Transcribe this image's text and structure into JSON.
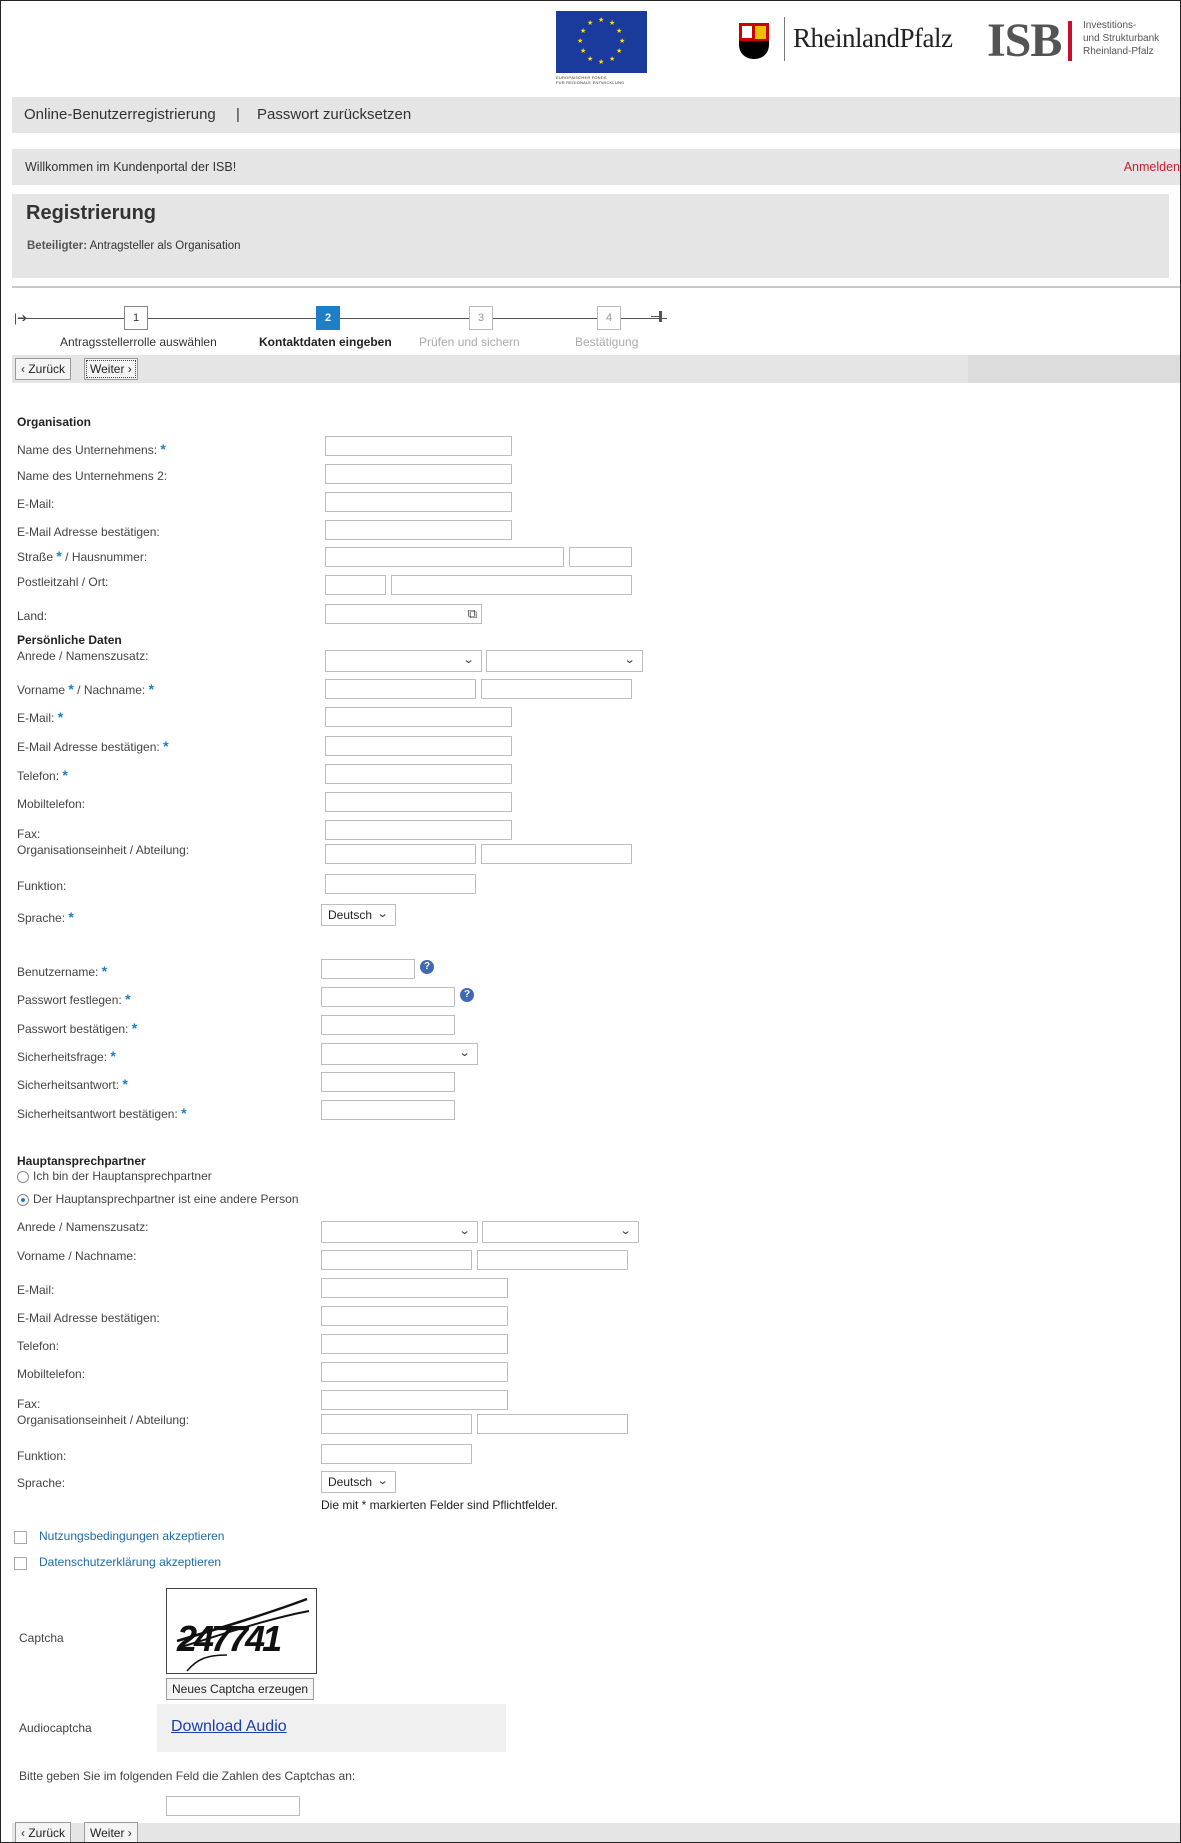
{
  "header": {
    "eu_caption_line1": "EUROPÄISCHER FONDS",
    "eu_caption_line2": "FÜR REGIONALE ENTWICKLUNG",
    "rlp_name": "RheinlandPfalz",
    "isb_letters": "ISB",
    "isb_sub1": "Investitions-",
    "isb_sub2": "und Strukturbank",
    "isb_sub3": "Rheinland-Pfalz"
  },
  "nav": {
    "registration": "Online-Benutzerregistrierung",
    "separator": "|",
    "reset": "Passwort zurücksetzen"
  },
  "welcome": {
    "text": "Willkommen im Kundenportal der ISB!",
    "login": "Anmelden"
  },
  "page": {
    "title": "Registrierung",
    "participant_label": "Beteiligter:",
    "participant_value": "Antragsteller als Organisation"
  },
  "wizard": {
    "steps": [
      {
        "num": "1",
        "label": "Antragsstellerrolle auswählen"
      },
      {
        "num": "2",
        "label": "Kontaktdaten eingeben"
      },
      {
        "num": "3",
        "label": "Prüfen und sichern"
      },
      {
        "num": "4",
        "label": "Bestätigung"
      }
    ],
    "current_step": 2
  },
  "buttons": {
    "back": "Zurück",
    "next": "Weiter"
  },
  "org": {
    "heading": "Organisation",
    "company": "Name des Unternehmens:",
    "company2": "Name des Unternehmens 2:",
    "email": "E-Mail:",
    "email_confirm": "E-Mail Adresse bestätigen:",
    "street": "Straße",
    "street_sep": "/ Hausnummer:",
    "postal": "Postleitzahl  /  Ort:",
    "country": "Land:"
  },
  "personal": {
    "heading": "Persönliche Daten",
    "salutation": "Anrede  /  Namenszusatz:",
    "firstname": "Vorname",
    "lastname_sep": "/ Nachname:",
    "email": "E-Mail:",
    "email_confirm": "E-Mail Adresse bestätigen:",
    "phone": "Telefon:",
    "mobile": "Mobiltelefon:",
    "fax": "Fax:",
    "unit": "Organisationseinheit  /  Abteilung:",
    "function": "Funktion:",
    "language": "Sprache:",
    "language_value": "Deutsch"
  },
  "account": {
    "username": "Benutzername:",
    "password": "Passwort festlegen:",
    "password_confirm": "Passwort bestätigen:",
    "question": "Sicherheitsfrage:",
    "answer": "Sicherheitsantwort:",
    "answer_confirm": "Sicherheitsantwort bestätigen:"
  },
  "contact": {
    "heading": "Hauptansprechpartner",
    "option1": "Ich bin der Hauptansprechpartner",
    "option2": "Der Hauptansprechpartner ist eine andere Person",
    "salutation": "Anrede  /  Namenszusatz:",
    "name": "Vorname  /  Nachname:",
    "email": "E-Mail:",
    "email_confirm": "E-Mail Adresse bestätigen:",
    "phone": "Telefon:",
    "mobile": "Mobiltelefon:",
    "fax": "Fax:",
    "unit": "Organisationseinheit  /  Abteilung:",
    "function": "Funktion:",
    "language": "Sprache:",
    "language_value": "Deutsch",
    "required_note": "Die mit * markierten Felder sind Pflichtfelder."
  },
  "required_mark": "*",
  "terms": {
    "usage": "Nutzungsbedingungen akzeptieren",
    "privacy": "Datenschutzerklärung akzeptieren"
  },
  "captcha": {
    "label": "Captcha",
    "image_text": "247741",
    "new_button": "Neues Captcha erzeugen",
    "audio_label": "Audiocaptcha",
    "download": "Download Audio",
    "instruction": "Bitte geben Sie im folgenden Feld die Zahlen des Captchas an:"
  },
  "colors": {
    "accent": "#1e7fc6",
    "login_red": "#c0212f",
    "link": "#1e6aa8",
    "bar_gray": "#e5e5e5"
  }
}
